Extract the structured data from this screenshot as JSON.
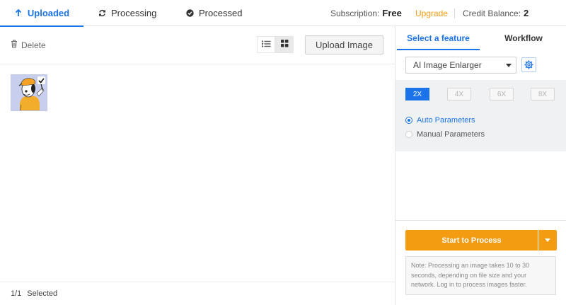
{
  "tabs": [
    {
      "label": "Uploaded",
      "icon": "arrow-up-icon",
      "active": true
    },
    {
      "label": "Processing",
      "icon": "sync-icon",
      "active": false
    },
    {
      "label": "Processed",
      "icon": "check-circle-icon",
      "active": false
    }
  ],
  "account": {
    "subscription_label": "Subscription:",
    "subscription_value": "Free",
    "upgrade_label": "Upgrade",
    "credit_label": "Credit Balance:",
    "credit_value": "2"
  },
  "toolbar": {
    "delete_label": "Delete",
    "upload_label": "Upload Image",
    "view_mode": "grid"
  },
  "images": [
    {
      "selected": true
    }
  ],
  "footer": {
    "count": "1/1",
    "selected_label": "Selected"
  },
  "panel": {
    "tabs": [
      {
        "label": "Select a feature",
        "active": true
      },
      {
        "label": "Workflow",
        "active": false
      }
    ],
    "feature_selected": "AI Image Enlarger",
    "scales": [
      "2X",
      "4X",
      "6X",
      "8X"
    ],
    "scale_selected": "2X",
    "params": [
      {
        "label": "Auto Parameters",
        "checked": true
      },
      {
        "label": "Manual Parameters",
        "checked": false
      }
    ],
    "process_label": "Start to Process",
    "note": "Note: Processing an image takes 10 to 30 seconds, depending on file size and your network. Log in to process images faster."
  },
  "colors": {
    "accent": "#1a73e8",
    "orange": "#f39c12"
  }
}
